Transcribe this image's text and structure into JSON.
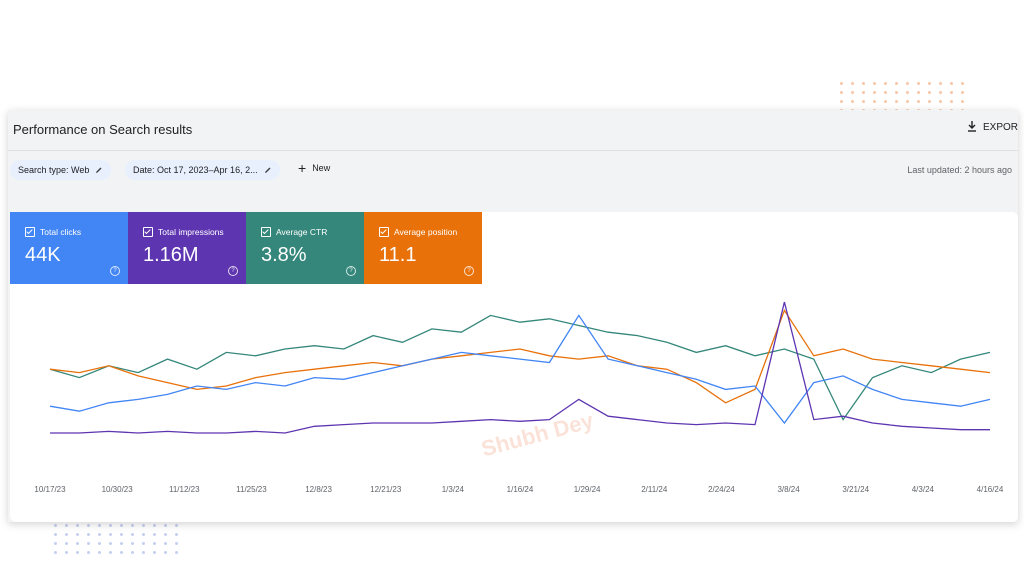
{
  "panel": {
    "title": "Performance on Search results",
    "export_label": "EXPOR",
    "export_icon": "download-icon"
  },
  "filters": {
    "search_type": "Search type: Web",
    "date": "Date: Oct 17, 2023–Apr 16, 2...",
    "new_label": "New",
    "last_updated": "Last updated: 2 hours ago"
  },
  "metrics": [
    {
      "label": "Total clicks",
      "value": "44K",
      "color": "#4285f4"
    },
    {
      "label": "Total impressions",
      "value": "1.16M",
      "color": "#5e35b1"
    },
    {
      "label": "Average CTR",
      "value": "3.8%",
      "color": "#34877a"
    },
    {
      "label": "Average position",
      "value": "11.1",
      "color": "#e8710a"
    }
  ],
  "watermark": "Shubh Dey",
  "chart_data": {
    "type": "line",
    "x_ticks": [
      "10/17/23",
      "10/30/23",
      "11/12/23",
      "11/25/23",
      "12/8/23",
      "12/21/23",
      "1/3/24",
      "1/16/24",
      "1/29/24",
      "2/11/24",
      "2/24/24",
      "3/8/24",
      "3/21/24",
      "4/3/24",
      "4/16/24"
    ],
    "series": [
      {
        "color": "#34877a",
        "values": [
          0.6,
          0.55,
          0.62,
          0.58,
          0.66,
          0.6,
          0.7,
          0.68,
          0.72,
          0.74,
          0.72,
          0.8,
          0.76,
          0.84,
          0.82,
          0.92,
          0.88,
          0.9,
          0.86,
          0.82,
          0.8,
          0.76,
          0.7,
          0.74,
          0.68,
          0.72,
          0.66,
          0.3,
          0.55,
          0.62,
          0.58,
          0.66,
          0.7
        ]
      },
      {
        "color": "#e8710a",
        "values": [
          0.6,
          0.58,
          0.62,
          0.56,
          0.52,
          0.48,
          0.5,
          0.55,
          0.58,
          0.6,
          0.62,
          0.64,
          0.62,
          0.66,
          0.68,
          0.7,
          0.72,
          0.68,
          0.66,
          0.68,
          0.62,
          0.6,
          0.52,
          0.4,
          0.48,
          0.95,
          0.68,
          0.72,
          0.66,
          0.64,
          0.62,
          0.6,
          0.58
        ]
      },
      {
        "color": "#4285f4",
        "values": [
          0.38,
          0.35,
          0.4,
          0.42,
          0.45,
          0.5,
          0.48,
          0.52,
          0.5,
          0.55,
          0.54,
          0.58,
          0.62,
          0.66,
          0.7,
          0.68,
          0.66,
          0.64,
          0.92,
          0.66,
          0.62,
          0.58,
          0.54,
          0.48,
          0.5,
          0.28,
          0.52,
          0.56,
          0.48,
          0.42,
          0.4,
          0.38,
          0.42
        ]
      },
      {
        "color": "#5e35b1",
        "values": [
          0.22,
          0.22,
          0.23,
          0.22,
          0.23,
          0.22,
          0.22,
          0.23,
          0.22,
          0.26,
          0.27,
          0.28,
          0.28,
          0.28,
          0.29,
          0.3,
          0.29,
          0.3,
          0.42,
          0.32,
          0.3,
          0.28,
          0.27,
          0.28,
          0.27,
          1.0,
          0.3,
          0.32,
          0.28,
          0.26,
          0.25,
          0.24,
          0.24
        ]
      }
    ]
  }
}
